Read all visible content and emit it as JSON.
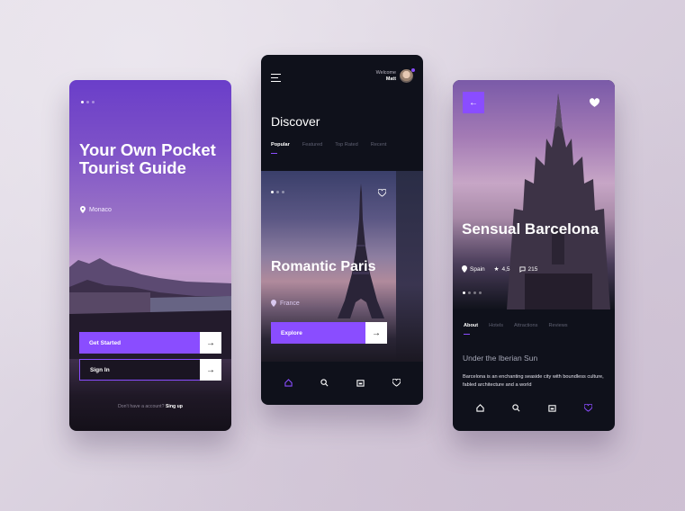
{
  "accent": "#8a4dff",
  "onboarding": {
    "title": "Your Own Pocket Tourist Guide",
    "location": "Monaco",
    "get_started": "Get Started",
    "sign_in": "Sign In",
    "footer_text": "Don't have a account?",
    "footer_link": "Sing up"
  },
  "discover": {
    "welcome": "Welcome",
    "user": "Matt",
    "heading": "Discover",
    "tabs": [
      "Popular",
      "Featured",
      "Top Rated",
      "Recent"
    ],
    "active_tab": "Popular",
    "card_title": "Romantic Paris",
    "card_location": "France",
    "explore": "Explore",
    "nav_icons": [
      "home-icon",
      "search-icon",
      "calendar-icon",
      "heart-icon"
    ]
  },
  "detail": {
    "title": "Sensual Barcelona",
    "country": "Spain",
    "rating": "4,5",
    "comments": "215",
    "tabs": [
      "About",
      "Hotels",
      "Attractions",
      "Reviews"
    ],
    "active_tab": "About",
    "subtitle": "Under the Iberian Sun",
    "description": "Barcelona is an enchanting seaside city with boundless culture, fabled architecture and a world",
    "nav_icons": [
      "home-icon",
      "search-icon",
      "calendar-icon",
      "heart-icon"
    ]
  }
}
